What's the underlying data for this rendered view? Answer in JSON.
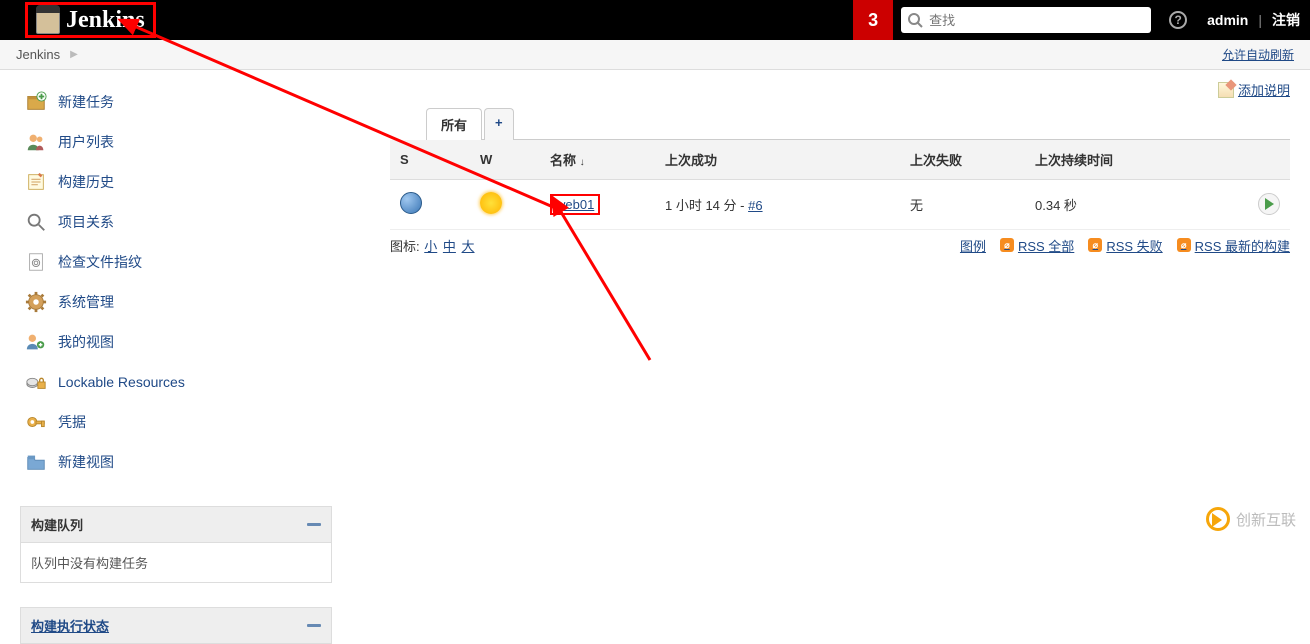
{
  "header": {
    "logo_text": "Jenkins",
    "notif_count": "3",
    "search_placeholder": "查找",
    "help_symbol": "?",
    "user": "admin",
    "logout": "注销"
  },
  "breadcrumb": {
    "item": "Jenkins",
    "auto_refresh": "允许自动刷新"
  },
  "sidebar": {
    "items": [
      {
        "label": "新建任务",
        "icon": "new-item-icon"
      },
      {
        "label": "用户列表",
        "icon": "people-icon"
      },
      {
        "label": "构建历史",
        "icon": "history-icon"
      },
      {
        "label": "项目关系",
        "icon": "relation-icon"
      },
      {
        "label": "检查文件指纹",
        "icon": "fingerprint-icon"
      },
      {
        "label": "系统管理",
        "icon": "gear-icon"
      },
      {
        "label": "我的视图",
        "icon": "my-views-icon"
      },
      {
        "label": "Lockable Resources",
        "icon": "lockable-icon"
      },
      {
        "label": "凭据",
        "icon": "credentials-icon"
      },
      {
        "label": "新建视图",
        "icon": "new-view-icon"
      }
    ]
  },
  "queue_panel": {
    "title": "构建队列",
    "body": "队列中没有构建任务"
  },
  "exec_panel": {
    "title": "构建执行状态"
  },
  "main": {
    "add_description": "添加说明",
    "tabs": {
      "all": "所有",
      "plus": "+"
    },
    "columns": {
      "s": "S",
      "w": "W",
      "name": "名称",
      "name_sort": "↓",
      "last_success": "上次成功",
      "last_failure": "上次失败",
      "last_duration": "上次持续时间"
    },
    "rows": [
      {
        "name": "web01",
        "last_success_text": "1 小时 14 分 - ",
        "last_success_build": "#6",
        "last_failure": "无",
        "last_duration": "0.34 秒"
      }
    ],
    "legend": {
      "prefix": "图标:",
      "small": "小",
      "medium": "中",
      "large": "大",
      "legend_link": "图例",
      "rss_all": "RSS 全部",
      "rss_fail": "RSS 失败",
      "rss_latest": "RSS 最新的构建"
    }
  },
  "watermark": "创新互联"
}
